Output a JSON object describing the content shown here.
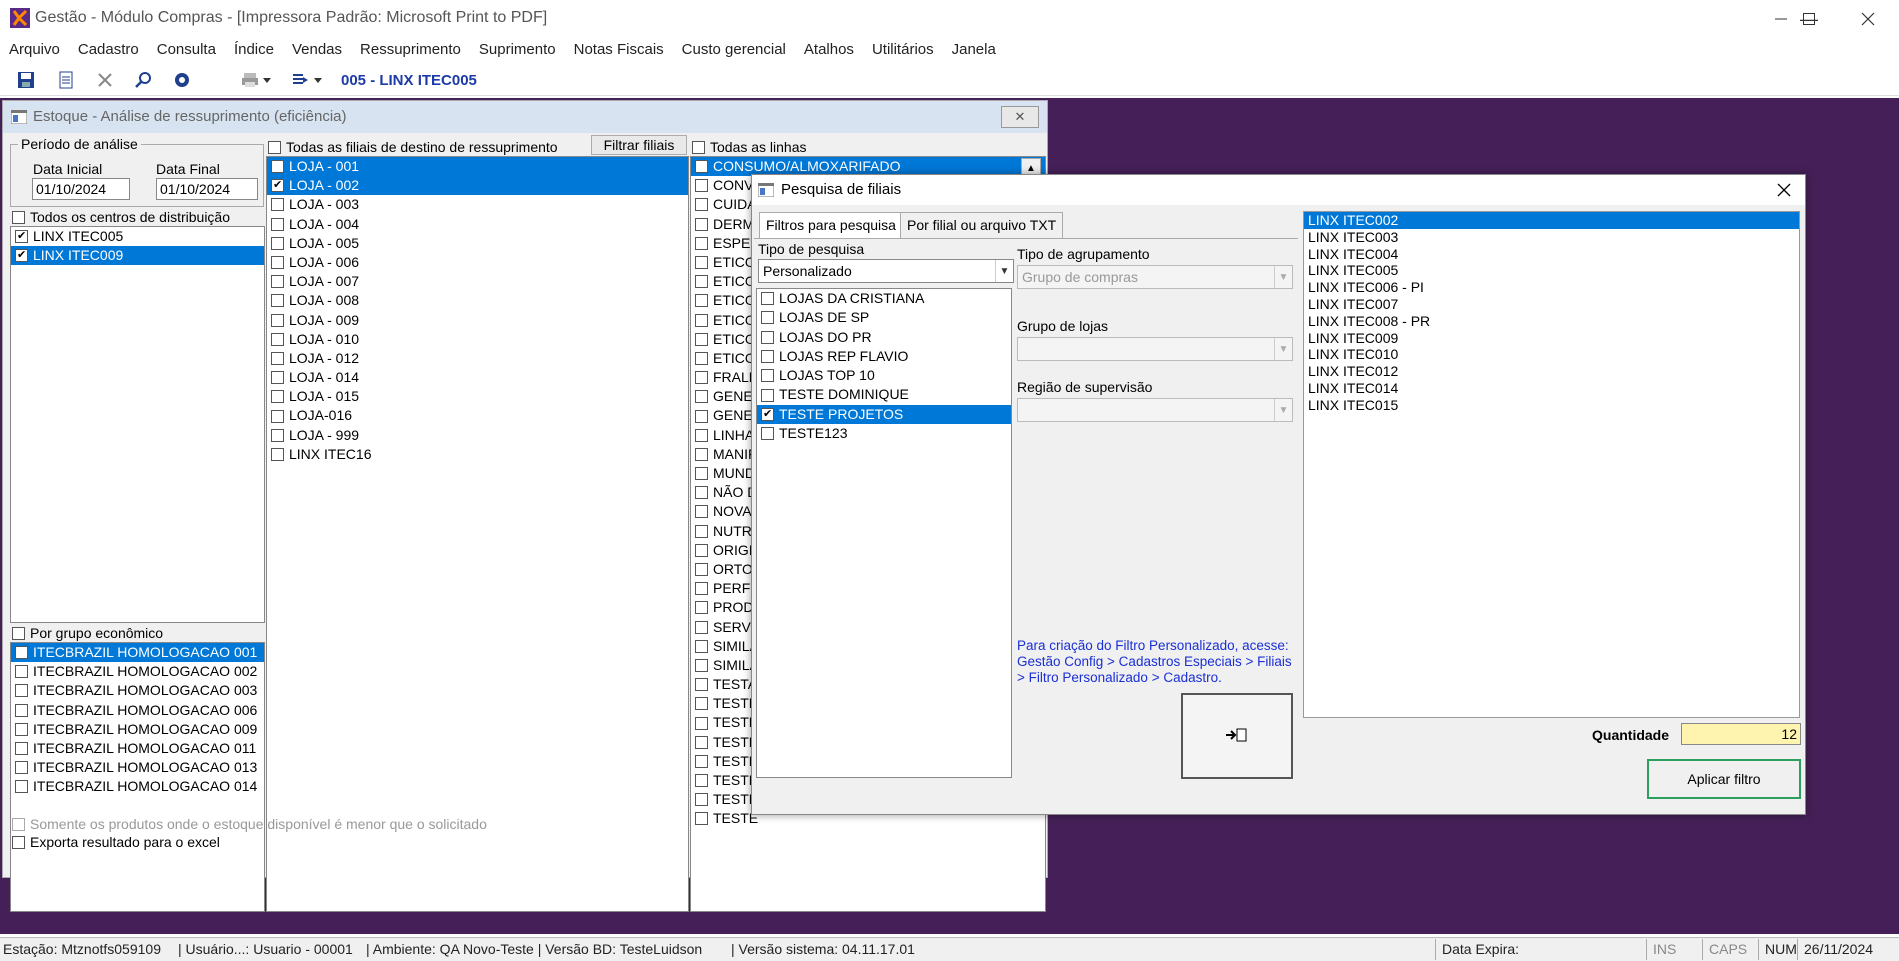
{
  "window": {
    "title": "Gestão  - Módulo Compras - [Impressora Padrão: Microsoft Print to PDF]"
  },
  "menu": [
    "Arquivo",
    "Cadastro",
    "Consulta",
    "Índice",
    "Vendas",
    "Ressuprimento",
    "Suprimento",
    "Notas Fiscais",
    "Custo gerencial",
    "Atalhos",
    "Utilitários",
    "Janela"
  ],
  "toolbar": {
    "title": "005 - LINX ITEC005",
    "icons": [
      "save-icon",
      "new-document-icon",
      "delete-icon",
      "search-icon",
      "settings-icon",
      "print-icon",
      "export-icon"
    ]
  },
  "estoque": {
    "title": "Estoque - Análise de ressuprimento (eficiência)",
    "periodo_label": "Período de análise",
    "data_inicial_label": "Data Inicial",
    "data_inicial": "01/10/2024",
    "data_final_label": "Data Final",
    "data_final": "01/10/2024",
    "centros_label": "Todos os centros de distribuição",
    "centros": [
      {
        "label": "LINX ITEC005",
        "checked": true,
        "selected": false
      },
      {
        "label": "LINX ITEC009",
        "checked": true,
        "selected": true
      }
    ],
    "grupo_label": "Por grupo econômico",
    "grupos": [
      {
        "label": "ITECBRAZIL HOMOLOGACAO 001",
        "checked": false,
        "selected": true
      },
      {
        "label": "ITECBRAZIL HOMOLOGACAO 002",
        "checked": false,
        "selected": false
      },
      {
        "label": "ITECBRAZIL HOMOLOGACAO 003",
        "checked": false,
        "selected": false
      },
      {
        "label": "ITECBRAZIL HOMOLOGACAO 006",
        "checked": false,
        "selected": false
      },
      {
        "label": "ITECBRAZIL HOMOLOGACAO 009",
        "checked": false,
        "selected": false
      },
      {
        "label": "ITECBRAZIL HOMOLOGACAO 011",
        "checked": false,
        "selected": false
      },
      {
        "label": "ITECBRAZIL HOMOLOGACAO 013",
        "checked": false,
        "selected": false
      },
      {
        "label": "ITECBRAZIL HOMOLOGACAO 014",
        "checked": false,
        "selected": false
      }
    ],
    "filiais_label": "Todas as filiais de destino de ressuprimento",
    "filtrar_button": "Filtrar filiais",
    "filiais": [
      {
        "label": "LOJA - 001",
        "checked": false,
        "selected": true
      },
      {
        "label": "LOJA - 002",
        "checked": true,
        "selected": true
      },
      {
        "label": "LOJA - 003",
        "checked": false,
        "selected": false
      },
      {
        "label": "LOJA - 004",
        "checked": false,
        "selected": false
      },
      {
        "label": "LOJA - 005",
        "checked": false,
        "selected": false
      },
      {
        "label": "LOJA - 006",
        "checked": false,
        "selected": false
      },
      {
        "label": "LOJA - 007",
        "checked": false,
        "selected": false
      },
      {
        "label": "LOJA - 008",
        "checked": false,
        "selected": false
      },
      {
        "label": "LOJA - 009",
        "checked": false,
        "selected": false
      },
      {
        "label": "LOJA - 010",
        "checked": false,
        "selected": false
      },
      {
        "label": "LOJA - 012",
        "checked": false,
        "selected": false
      },
      {
        "label": "LOJA - 014",
        "checked": false,
        "selected": false
      },
      {
        "label": "LOJA - 015",
        "checked": false,
        "selected": false
      },
      {
        "label": "LOJA-016",
        "checked": false,
        "selected": false
      },
      {
        "label": "LOJA - 999",
        "checked": false,
        "selected": false
      },
      {
        "label": "LINX ITEC16",
        "checked": false,
        "selected": false
      }
    ],
    "linhas_label": "Todas as linhas",
    "linhas": [
      {
        "label": "CONSUMO/ALMOXARIFADO",
        "checked": false,
        "selected": true
      },
      {
        "label": "CONVE",
        "checked": false,
        "selected": false
      },
      {
        "label": "CUIDA",
        "checked": false,
        "selected": false
      },
      {
        "label": "DERM",
        "checked": false,
        "selected": false
      },
      {
        "label": "ESPEC",
        "checked": false,
        "selected": false
      },
      {
        "label": "ETICO",
        "checked": false,
        "selected": false
      },
      {
        "label": "ETICO",
        "checked": false,
        "selected": false
      },
      {
        "label": "ETICO",
        "checked": false,
        "selected": false
      },
      {
        "label": "ETICO",
        "checked": false,
        "selected": false
      },
      {
        "label": "ETICO",
        "checked": false,
        "selected": false
      },
      {
        "label": "ETICO",
        "checked": false,
        "selected": false
      },
      {
        "label": "FRALD",
        "checked": false,
        "selected": false
      },
      {
        "label": "GENEF",
        "checked": false,
        "selected": false
      },
      {
        "label": "GENEF",
        "checked": false,
        "selected": false
      },
      {
        "label": "LINHA",
        "checked": false,
        "selected": false
      },
      {
        "label": "MANIF",
        "checked": false,
        "selected": false
      },
      {
        "label": "MUND",
        "checked": false,
        "selected": false
      },
      {
        "label": "NÃO D",
        "checked": false,
        "selected": false
      },
      {
        "label": "NOVA",
        "checked": false,
        "selected": false
      },
      {
        "label": "NUTRI",
        "checked": false,
        "selected": false
      },
      {
        "label": "ORIGI",
        "checked": false,
        "selected": false
      },
      {
        "label": "ORTOI",
        "checked": false,
        "selected": false
      },
      {
        "label": "PERFU",
        "checked": false,
        "selected": false
      },
      {
        "label": "PRODI",
        "checked": false,
        "selected": false
      },
      {
        "label": "SERVI",
        "checked": false,
        "selected": false
      },
      {
        "label": "SIMILA",
        "checked": false,
        "selected": false
      },
      {
        "label": "SIMILA",
        "checked": false,
        "selected": false
      },
      {
        "label": "TESTA",
        "checked": false,
        "selected": false
      },
      {
        "label": "TESTE",
        "checked": false,
        "selected": false
      },
      {
        "label": "TESTE",
        "checked": false,
        "selected": false
      },
      {
        "label": "TESTE",
        "checked": false,
        "selected": false
      },
      {
        "label": "TESTE",
        "checked": false,
        "selected": false
      },
      {
        "label": "TESTE",
        "checked": false,
        "selected": false
      },
      {
        "label": "TESTE",
        "checked": false,
        "selected": false
      },
      {
        "label": "TESTE",
        "checked": false,
        "selected": false
      }
    ],
    "somente_label": "Somente os produtos onde o estoque disponível é menor que o solicitado",
    "exporta_label": "Exporta resultado para o excel"
  },
  "pesquisa": {
    "title": "Pesquisa de filiais",
    "tabs": [
      "Filtros para pesquisa",
      "Por filial ou arquivo TXT"
    ],
    "tipo_pesquisa_label": "Tipo de pesquisa",
    "tipo_pesquisa_value": "Personalizado",
    "filtros": [
      {
        "label": "LOJAS DA CRISTIANA",
        "checked": false,
        "selected": false
      },
      {
        "label": "LOJAS DE SP",
        "checked": false,
        "selected": false
      },
      {
        "label": "LOJAS DO PR",
        "checked": false,
        "selected": false
      },
      {
        "label": "LOJAS REP FLAVIO",
        "checked": false,
        "selected": false
      },
      {
        "label": "LOJAS TOP 10",
        "checked": false,
        "selected": false
      },
      {
        "label": "TESTE DOMINIQUE",
        "checked": false,
        "selected": false
      },
      {
        "label": "TESTE PROJETOS",
        "checked": true,
        "selected": true
      },
      {
        "label": "TESTE123",
        "checked": false,
        "selected": false
      }
    ],
    "agrupamento_label": "Tipo de agrupamento",
    "agrupamento_value": "Grupo de compras",
    "grupo_lojas_label": "Grupo de lojas",
    "grupo_lojas_value": "",
    "regiao_label": "Região de supervisão",
    "regiao_value": "",
    "help_text": "Para criação do Filtro Personalizado, acesse: Gestão Config > Cadastros Especiais > Filiais > Filtro Personalizado > Cadastro.",
    "results": [
      {
        "label": "LINX ITEC002",
        "selected": true
      },
      {
        "label": "LINX ITEC003",
        "selected": false
      },
      {
        "label": "LINX ITEC004",
        "selected": false
      },
      {
        "label": "LINX ITEC005",
        "selected": false
      },
      {
        "label": "LINX ITEC006 - PI",
        "selected": false
      },
      {
        "label": "LINX ITEC007",
        "selected": false
      },
      {
        "label": "LINX ITEC008 - PR",
        "selected": false
      },
      {
        "label": "LINX ITEC009",
        "selected": false
      },
      {
        "label": "LINX ITEC010",
        "selected": false
      },
      {
        "label": "LINX ITEC012",
        "selected": false
      },
      {
        "label": "LINX ITEC014",
        "selected": false
      },
      {
        "label": "LINX ITEC015",
        "selected": false
      }
    ],
    "quantidade_label": "Quantidade",
    "quantidade_value": "12",
    "aplicar_button": "Aplicar filtro"
  },
  "status": {
    "estacao": "Estação: Mtznotfs059109",
    "usuario": "| Usuário...: Usuario - 00001",
    "ambiente": "| Ambiente: QA Novo-Teste | Versão BD: TesteLuidson",
    "versao": "| Versão sistema: 04.11.17.01",
    "data_expira": "Data Expira:",
    "ins": "INS",
    "caps": "CAPS",
    "num": "NUM",
    "date": "26/11/2024"
  },
  "colors": {
    "desktop": "#452058",
    "selection": "#0078d7",
    "accent_title": "#1c3aa8",
    "help_text": "#1a2fd6",
    "quantidade_bg": "#fff3b0",
    "aplicar_border": "#2e9e5e"
  }
}
